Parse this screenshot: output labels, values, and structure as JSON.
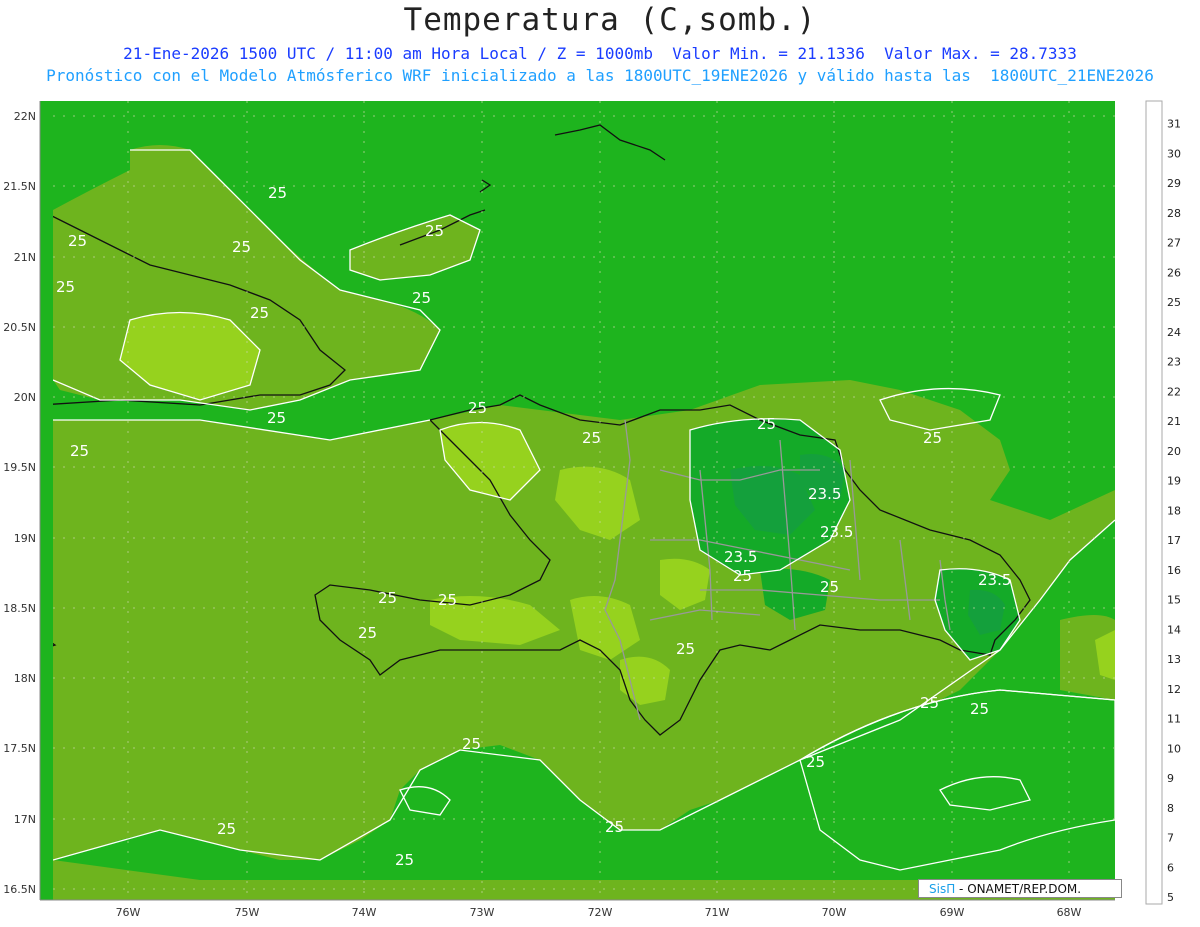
{
  "header": {
    "title": "Temperatura (C,somb.)",
    "line1": "21-Ene-2026 1500 UTC / 11:00 am Hora Local / Z = 1000mb  Valor Min. = 21.1336  Valor Max. = 28.7333",
    "line2": "Pronóstico con el Modelo Atmósferico WRF inicializado a las 1800UTC_19ENE2026 y válido hasta las  1800UTC_21ENE2026"
  },
  "axes": {
    "lat_labels": [
      "22N",
      "21.5N",
      "21N",
      "20.5N",
      "20N",
      "19.5N",
      "19N",
      "18.5N",
      "18N",
      "17.5N",
      "17N",
      "16.5N"
    ],
    "lon_labels": [
      "76W",
      "75W",
      "74W",
      "73W",
      "72W",
      "71W",
      "70W",
      "69W",
      "68W"
    ]
  },
  "colorbar": {
    "labels": [
      "31",
      "30",
      "29",
      "28",
      "27",
      "26",
      "25",
      "24",
      "23",
      "22",
      "21",
      "20",
      "19",
      "18",
      "17",
      "16",
      "15",
      "14",
      "13",
      "12",
      "11",
      "10",
      "9",
      "8",
      "7",
      "6",
      "5"
    ],
    "colors": [
      "#c88000",
      "#e0a000",
      "#ffc800",
      "#fff000",
      "#c8f020",
      "#96d21e",
      "#6eb41e",
      "#1eb41e",
      "#14aa28",
      "#14a03c",
      "#0a8c50",
      "#0a7864",
      "#0a6e82",
      "#1464a0",
      "#1e5ac8",
      "#1e46d2",
      "#1432c8",
      "#1428b4",
      "#0a14a0",
      "#1e1ea0",
      "#3232aa",
      "#5050b4",
      "#7878b4",
      "#9696aa",
      "#aaaaaa",
      "#c8c8c8",
      "#ffffff"
    ]
  },
  "contour_labels": [
    "25",
    "25",
    "25",
    "25",
    "25",
    "25",
    "25",
    "25",
    "25",
    "25",
    "25",
    "25",
    "25",
    "25",
    "25",
    "25",
    "25",
    "25",
    "25",
    "25",
    "25",
    "25",
    "25",
    "25",
    "25",
    "25",
    "23.5",
    "23.5",
    "23.5",
    "23.5"
  ],
  "credit": {
    "brand": "SisΠ",
    "text": " - ONAMET/REP.DOM."
  }
}
